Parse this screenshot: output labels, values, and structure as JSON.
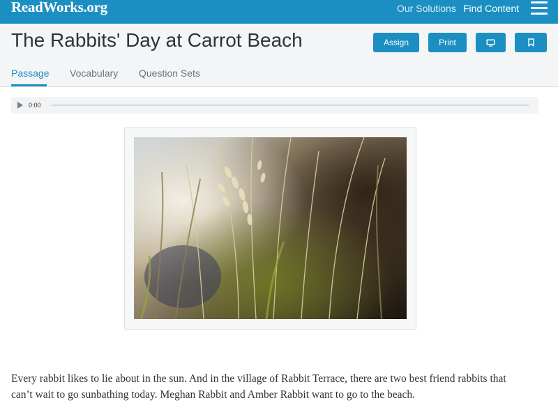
{
  "header": {
    "logo": "ReadWorks.org",
    "nav": [
      "Our Solutions",
      "Find Content"
    ]
  },
  "article": {
    "title": "The Rabbits' Day at Carrot Beach",
    "buttons": {
      "assign": "Assign",
      "print": "Print"
    },
    "tabs": [
      "Passage",
      "Vocabulary",
      "Question Sets"
    ],
    "active_tab": "Passage"
  },
  "audio": {
    "time": "0:00",
    "progress": 0
  },
  "passage": {
    "lines": [
      "Every rabbit likes to lie about in the sun. And in the village of Rabbit Terrace, there are two best friend rabbits that",
      "can’t wait to go sunbathing today. Meghan Rabbit and Amber Rabbit want to go to the beach."
    ]
  },
  "icons": {
    "menu": "hamburger-menu-icon",
    "present": "monitor-icon",
    "bookmark": "bookmark-icon",
    "play": "play-icon"
  },
  "colors": {
    "brand": "#1b8fc2",
    "header_bg": "#f4f5f6",
    "text": "#2f3437",
    "muted": "#6b7378"
  }
}
